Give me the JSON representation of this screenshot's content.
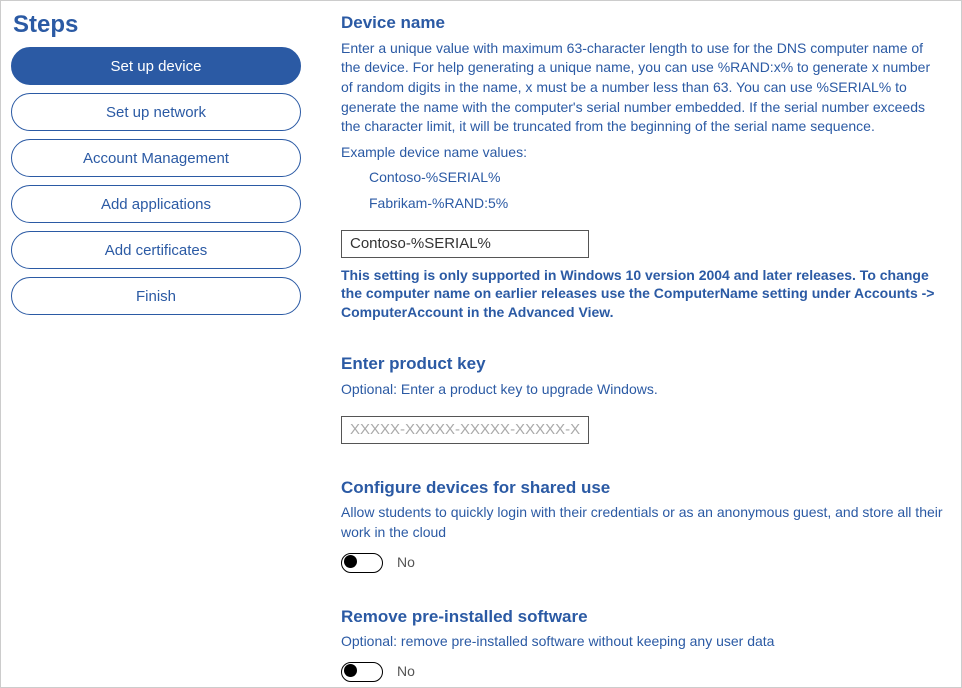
{
  "sidebar": {
    "heading": "Steps",
    "items": [
      {
        "label": "Set up device",
        "selected": true
      },
      {
        "label": "Set up network",
        "selected": false
      },
      {
        "label": "Account Management",
        "selected": false
      },
      {
        "label": "Add applications",
        "selected": false
      },
      {
        "label": "Add certificates",
        "selected": false
      },
      {
        "label": "Finish",
        "selected": false
      }
    ]
  },
  "device_name": {
    "heading": "Device name",
    "description": "Enter a unique value with maximum 63-character length to use for the DNS computer name of the device. For help generating a unique name, you can use %RAND:x% to generate x number of random digits in the name, x must be a number less than 63. You can use %SERIAL% to generate the name with the computer's serial number embedded. If the serial number exceeds the character limit, it will be truncated from the beginning of the serial name sequence.",
    "example_label": "Example device name values:",
    "example_values": [
      "Contoso-%SERIAL%",
      "Fabrikam-%RAND:5%"
    ],
    "input_value": "Contoso-%SERIAL%",
    "note": "This setting is only supported in Windows 10 version 2004 and later releases. To change the computer name on earlier releases use the ComputerName setting under Accounts -> ComputerAccount in the Advanced View."
  },
  "product_key": {
    "heading": "Enter product key",
    "description": "Optional: Enter a product key to upgrade Windows.",
    "placeholder": "XXXXX-XXXXX-XXXXX-XXXXX-XXXXX",
    "value": ""
  },
  "shared_use": {
    "heading": "Configure devices for shared use",
    "description": "Allow students to quickly login with their credentials or as an anonymous guest, and store all their work in the cloud",
    "toggle_value": false,
    "toggle_label": "No"
  },
  "remove_software": {
    "heading": "Remove pre-installed software",
    "description": "Optional: remove pre-installed software without keeping any user data",
    "toggle_value": false,
    "toggle_label": "No"
  }
}
